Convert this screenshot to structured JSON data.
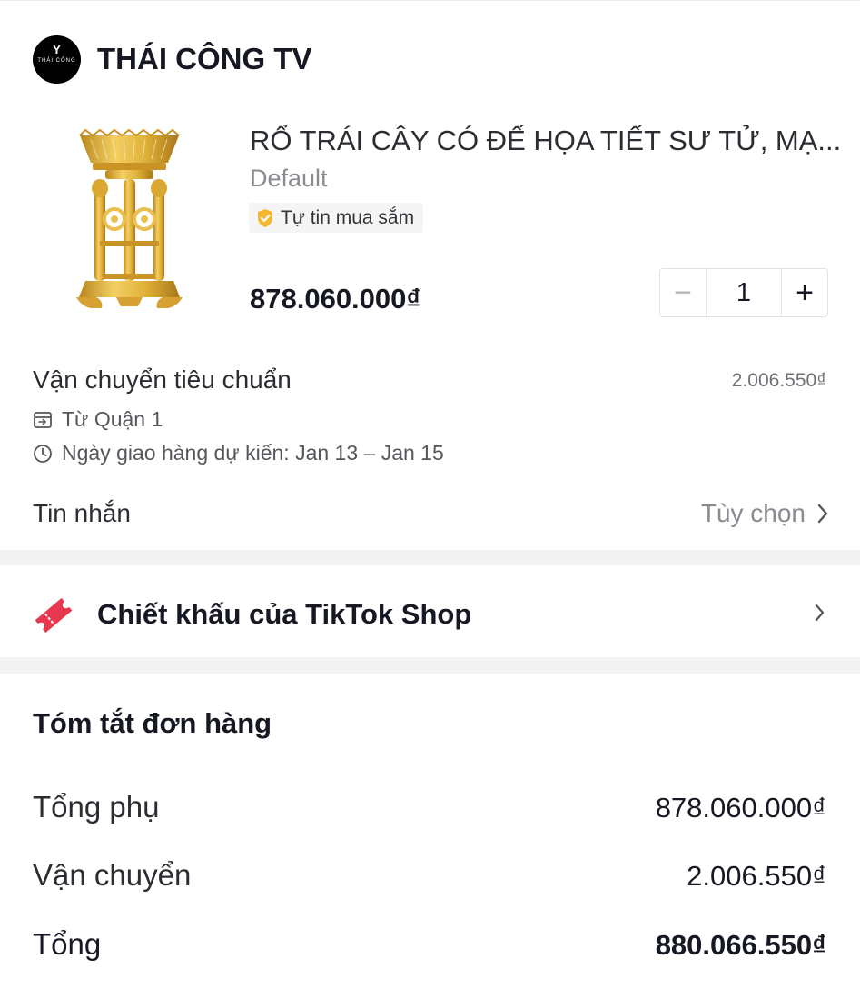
{
  "shop": {
    "name": "THÁI CÔNG TV",
    "logo_glyph": "Y",
    "logo_text": "THÁI CÔNG"
  },
  "product": {
    "title": "RỔ TRÁI CÂY CÓ ĐẾ HỌA TIẾT SƯ TỬ, MẠ...",
    "variant": "Default",
    "badge_label": "Tự tin mua sắm",
    "price": "878.060.000₫",
    "quantity": "1",
    "minus_symbol": "−",
    "plus_symbol": "+"
  },
  "shipping": {
    "title": "Vận chuyển tiêu chuẩn",
    "fee": "2.006.550₫",
    "from": "Từ  Quận 1",
    "estimated_delivery": "Ngày giao hàng dự kiến: Jan 13 – Jan 15"
  },
  "message": {
    "label": "Tin nhắn",
    "option": "Tùy chọn"
  },
  "discount": {
    "label": "Chiết khấu của TikTok Shop"
  },
  "summary": {
    "title": "Tóm tắt đơn hàng",
    "rows": [
      {
        "label": "Tổng phụ",
        "value": "878.060.000₫"
      },
      {
        "label": "Vận chuyển",
        "value": "2.006.550₫"
      },
      {
        "label": "Tổng",
        "value": "880.066.550₫"
      }
    ]
  },
  "icons": {
    "badge": "shield-check-icon",
    "from": "box-icon",
    "date": "clock-icon",
    "message_chevron": "chevron-right-icon",
    "discount": "ticket-icon",
    "discount_chevron": "chevron-right-icon"
  },
  "colors": {
    "text_primary": "#161823",
    "text_secondary": "#8a8b91",
    "badge_gold": "#f5b731",
    "ticket_red": "#e8384f",
    "product_gold": "#e2b23a",
    "divider": "#f3f3f4"
  }
}
